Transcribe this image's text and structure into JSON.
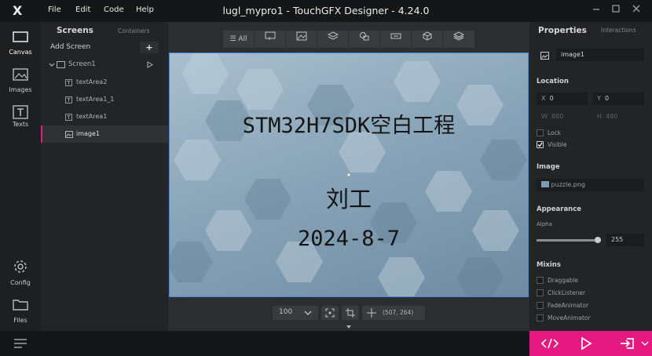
{
  "window": {
    "logo": "X",
    "menu": [
      "File",
      "Edit",
      "Code",
      "Help"
    ],
    "title": "lugl_mypro1 - TouchGFX Designer - 4.24.0"
  },
  "leftbar": {
    "items": [
      {
        "label": "Canvas",
        "icon": "canvas-icon"
      },
      {
        "label": "Images",
        "icon": "images-icon"
      },
      {
        "label": "Texts",
        "icon": "texts-icon"
      },
      {
        "label": "Config",
        "icon": "gear-icon"
      },
      {
        "label": "Files",
        "icon": "folder-icon"
      }
    ]
  },
  "screens": {
    "tab_active": "Screens",
    "tab_other": "Containers",
    "add_screen": "Add Screen",
    "add_icon": "+",
    "screen_name": "Screen1",
    "widgets": [
      {
        "name": "textArea2",
        "type": "text"
      },
      {
        "name": "textArea1_1",
        "type": "text"
      },
      {
        "name": "textArea1",
        "type": "text"
      },
      {
        "name": "image1",
        "type": "image"
      }
    ]
  },
  "canvas": {
    "top_tools_all": "All",
    "texts": [
      "STM32H7SDK空白工程",
      "刘工",
      "2024-8-7"
    ],
    "zoom": "100",
    "coords": "(507, 264)"
  },
  "properties": {
    "tab_active": "Properties",
    "tab_other": "Interactions",
    "widget_name": "image1",
    "location_title": "Location",
    "x_label": "X",
    "x_value": "0",
    "y_label": "Y",
    "y_value": "0",
    "w_label": "W",
    "w_value": "800",
    "h_label": "H",
    "h_value": "480",
    "lock_label": "Lock",
    "visible_label": "Visible",
    "image_title": "Image",
    "image_file": "puzzle.png",
    "appearance_title": "Appearance",
    "alpha_label": "Alpha",
    "alpha_value": "255",
    "alpha_fraction": 1.0,
    "mixins_title": "Mixins",
    "mixins": [
      "Draggable",
      "ClickListener",
      "FadeAnimator",
      "MoveAnimator"
    ]
  },
  "colors": {
    "accent_pink": "#e5197f",
    "selection_blue": "#3a8ee6",
    "titlebar": "#151617"
  }
}
